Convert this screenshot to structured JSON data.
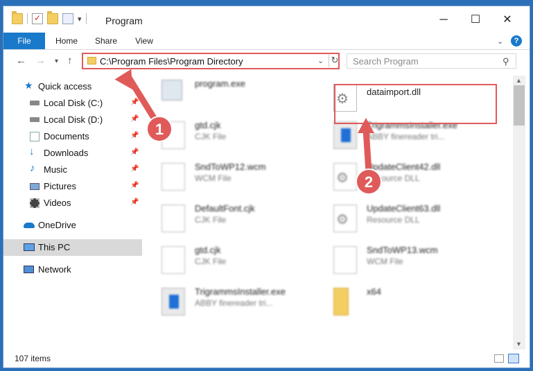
{
  "window": {
    "title": "Program",
    "controls": {
      "minimize": "─",
      "maximize": "☐",
      "close": "✕"
    }
  },
  "quick_access_toolbar": {
    "dropdown_glyph": "▾"
  },
  "ribbon": {
    "tabs": [
      "File",
      "Home",
      "Share",
      "View"
    ],
    "expand_glyph": "⌄",
    "help_glyph": "?"
  },
  "navigation": {
    "back_glyph": "←",
    "forward_glyph": "→",
    "recent_glyph": "▾",
    "up_glyph": "↑",
    "address": "C:\\Program Files\\Program Directory",
    "address_dropdown_glyph": "⌄",
    "refresh_glyph": "↻",
    "search_placeholder": "Search Program",
    "search_glyph": "⚲"
  },
  "sidebar": {
    "items": [
      {
        "label": "Quick access",
        "icon": "star-icon",
        "pinned": false
      },
      {
        "label": "Local Disk (C:)",
        "icon": "drive-icon",
        "pinned": true
      },
      {
        "label": "Local Disk (D:)",
        "icon": "drive-icon",
        "pinned": true
      },
      {
        "label": "Documents",
        "icon": "documents-icon",
        "pinned": true
      },
      {
        "label": "Downloads",
        "icon": "download-icon",
        "pinned": true
      },
      {
        "label": "Music",
        "icon": "music-icon",
        "pinned": true
      },
      {
        "label": "Pictures",
        "icon": "pictures-icon",
        "pinned": true
      },
      {
        "label": "Videos",
        "icon": "videos-icon",
        "pinned": true
      },
      {
        "label": "OneDrive",
        "icon": "cloud-icon",
        "pinned": false
      },
      {
        "label": "This PC",
        "icon": "computer-icon",
        "pinned": false,
        "selected": true
      },
      {
        "label": "Network",
        "icon": "network-icon",
        "pinned": false
      }
    ],
    "pin_glyph": "📌"
  },
  "files": [
    {
      "name": "program.exe",
      "type": "",
      "icon": "installer-icon"
    },
    {
      "name": "dataimport.dll",
      "type": "",
      "icon": "dll-gear-icon",
      "highlighted": true
    },
    {
      "name": "gtd.cjk",
      "type": "CJK File",
      "icon": "file-icon"
    },
    {
      "name": "TrigrammsInstaller.exe",
      "type": "ABBY finereader tri...",
      "icon": "app-icon"
    },
    {
      "name": "SndToWP12.wcm",
      "type": "WCM File",
      "icon": "file-icon"
    },
    {
      "name": "UpdateClient42.dll",
      "type": "Resource DLL",
      "icon": "dll-gear-icon"
    },
    {
      "name": "DefaultFont.cjk",
      "type": "CJK File",
      "icon": "file-icon"
    },
    {
      "name": "UpdateClient63.dll",
      "type": "Resource DLL",
      "icon": "dll-gear-icon"
    },
    {
      "name": "gtd.cjk",
      "type": "CJK File",
      "icon": "file-icon"
    },
    {
      "name": "SndToWP13.wcm",
      "type": "WCM File",
      "icon": "file-icon"
    },
    {
      "name": "TrigrammsInstaller.exe",
      "type": "ABBY finereader tri...",
      "icon": "app-icon"
    },
    {
      "name": "x64",
      "type": "",
      "icon": "folder-zip-icon"
    }
  ],
  "status": {
    "item_count": "107 items"
  },
  "annotations": [
    {
      "number": "1",
      "color": "#e05a5a"
    },
    {
      "number": "2",
      "color": "#e05a5a"
    }
  ],
  "colors": {
    "accent": "#1979ca",
    "highlight": "#e05a5a",
    "selected": "#d9d9d9"
  }
}
